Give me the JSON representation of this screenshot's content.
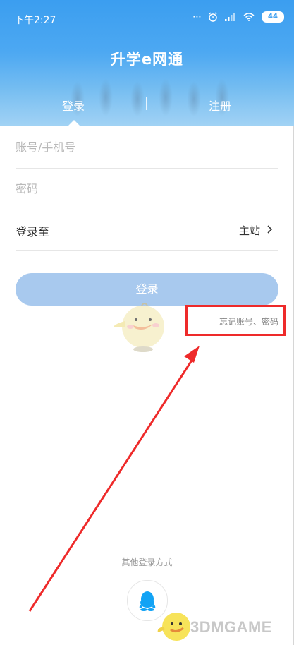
{
  "status_bar": {
    "time": "下午2:27",
    "battery": "44",
    "icons": [
      "more-dots-icon",
      "alarm-icon",
      "signal-icon",
      "wifi-icon",
      "battery-icon"
    ]
  },
  "header": {
    "title": "升学e网通",
    "tabs": [
      {
        "label": "登录",
        "active": true
      },
      {
        "label": "注册",
        "active": false
      }
    ]
  },
  "form": {
    "account_placeholder": "账号/手机号",
    "password_placeholder": "密码",
    "login_to_label": "登录至",
    "login_to_value": "主站",
    "login_button": "登录",
    "forgot_link": "忘记账号、密码"
  },
  "other_login": {
    "label": "其他登录方式",
    "providers": [
      "qq-icon"
    ]
  },
  "watermark": {
    "text": "3DMGAME"
  },
  "colors": {
    "header_blue": "#3b9ef0",
    "login_button": "#a8c9ee",
    "highlight_red": "#ee2a2a",
    "qq_blue": "#12a3f5"
  }
}
